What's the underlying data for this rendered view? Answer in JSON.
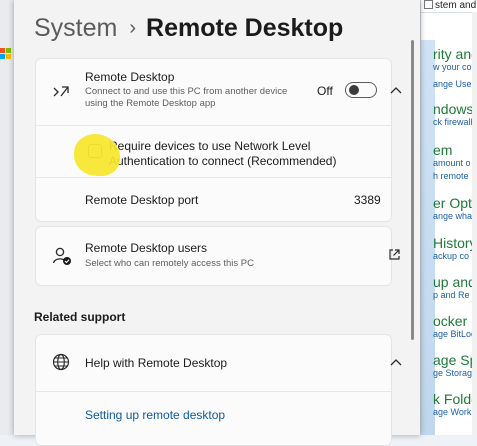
{
  "background": {
    "win_logo_colors": [
      "#f25022",
      "#7fba00",
      "#00a4ef",
      "#ffb900"
    ],
    "right_panel": {
      "top_text": "stem and",
      "items": [
        {
          "title": "rity and",
          "link": "w your co"
        },
        {
          "title": "",
          "link": "ange Use"
        },
        {
          "title": "ndows D",
          "link": "ck firewall s"
        },
        {
          "title": "em",
          "link": "amount o"
        },
        {
          "title": "",
          "link": "h remote"
        },
        {
          "title": "er Optic",
          "link": "ange what th"
        },
        {
          "title": "History",
          "link": "ackup co"
        },
        {
          "title": "up and",
          "link": "p and Re"
        },
        {
          "title": "ocker D",
          "link": "age BitLoc"
        },
        {
          "title": "age Spa",
          "link": "ge Storage"
        },
        {
          "title": "k Folde",
          "link": "age Work F"
        }
      ]
    }
  },
  "breadcrumb": {
    "parent": "System",
    "separator": "›",
    "current": "Remote Desktop"
  },
  "remote_desktop": {
    "title": "Remote Desktop",
    "description": "Connect to and use this PC from another device using the Remote Desktop app",
    "toggle_state": "Off",
    "icon": "remote-desktop-icon",
    "expand_icon": "chevron-up-icon"
  },
  "nla": {
    "label": "Require devices to use Network Level Authentication to connect (Recommended)",
    "checked": false
  },
  "port": {
    "label": "Remote Desktop port",
    "value": "3389"
  },
  "users": {
    "title": "Remote Desktop users",
    "description": "Select who can remotely access this PC",
    "icon": "user-check-icon",
    "action_icon": "open-external-icon"
  },
  "related_support": {
    "heading": "Related support",
    "help_title": "Help with Remote Desktop",
    "help_icon": "globe-icon",
    "expand_icon": "chevron-up-icon",
    "link": "Setting up remote desktop"
  },
  "colors": {
    "accent_link": "#0f5aa6",
    "highlight": "#f7e62a",
    "right_panel_title": "#1f7a3a"
  }
}
